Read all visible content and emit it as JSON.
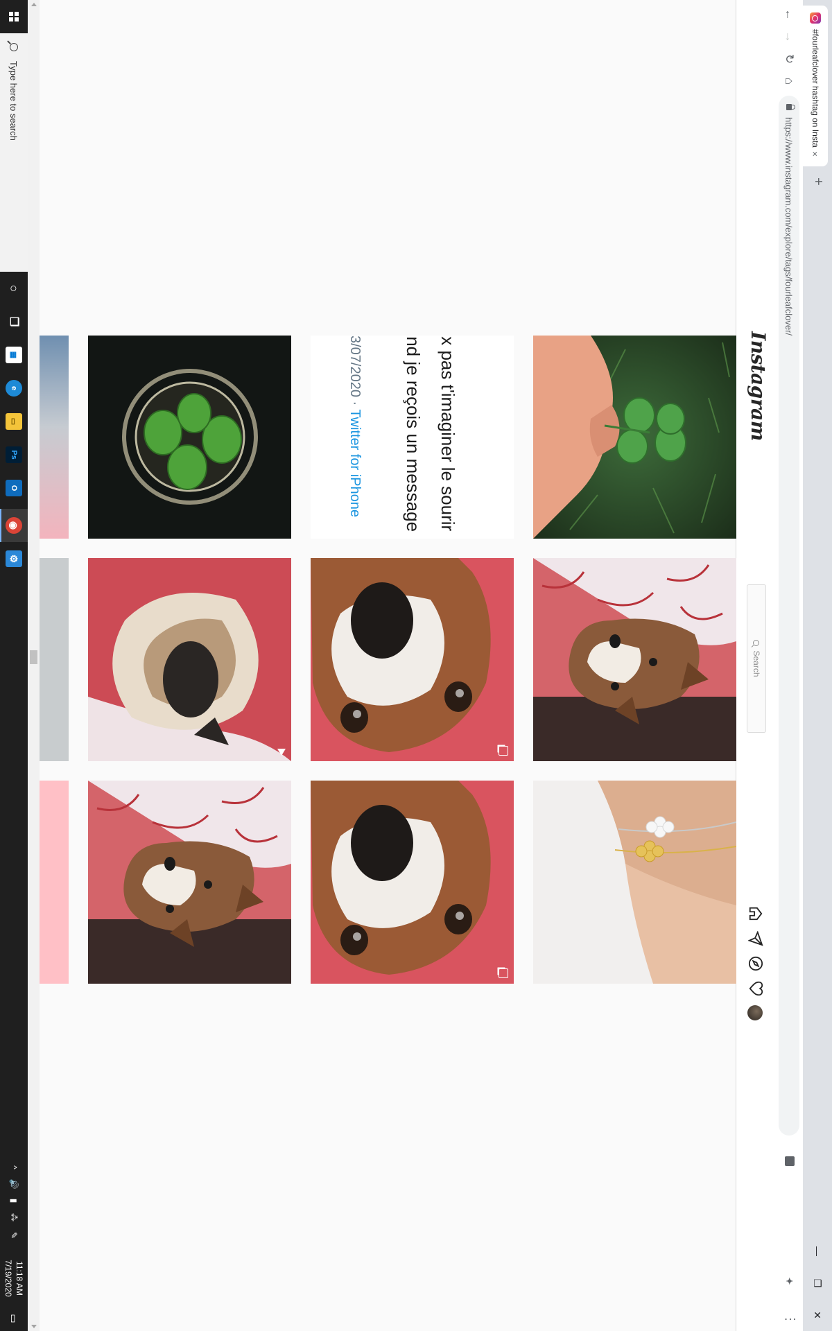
{
  "browser": {
    "tab_title": "#fourleafclover hashtag on Insta",
    "tab_close": "×",
    "new_tab": "+",
    "url": "https://www.instagram.com/explore/tags/fourleafclover/",
    "window_controls": [
      "—",
      "❐",
      "✕"
    ],
    "nav": {
      "back": "←",
      "forward": "→",
      "reload": "↻",
      "home": "⌂"
    },
    "extensions": [
      {
        "icon": "z-extension-icon",
        "color": "#8a6d5a",
        "glyph": "Z"
      },
      {
        "icon": "puzzle-extension-icon",
        "color": "#5f6368",
        "glyph": "✦"
      },
      {
        "icon": "image-extension-icon",
        "color": "#3b5b3b",
        "glyph": "▣"
      },
      {
        "icon": "b-extension-icon",
        "color": "#2b7de9",
        "glyph": "B"
      },
      {
        "icon": "circle-extension-icon",
        "color": "#9aa0a6",
        "glyph": "●"
      },
      {
        "icon": "x-extension-icon",
        "color": "#f97316",
        "glyph": "✕"
      },
      {
        "icon": "g-extension-icon",
        "color": "#8e8e8e",
        "glyph": "G"
      }
    ],
    "menu": "⋮",
    "split_icon": "▥"
  },
  "instagram": {
    "logo": "Instagram",
    "search_placeholder": "Search",
    "nav_icons": [
      "home-icon",
      "direct-icon",
      "explore-icon",
      "activity-icon",
      "avatar"
    ]
  },
  "posts": [
    {
      "name": "post-clover-fingers",
      "row": 0,
      "col": 0,
      "badge": ""
    },
    {
      "name": "post-corgi-blanket",
      "row": 0,
      "col": 1,
      "badge": ""
    },
    {
      "name": "post-clover-bracelet",
      "row": 0,
      "col": 2,
      "badge": ""
    },
    {
      "name": "post-tweet",
      "row": 1,
      "col": 0,
      "badge": ""
    },
    {
      "name": "post-corgi-closeup",
      "row": 1,
      "col": 1,
      "badge": "multi"
    },
    {
      "name": "post-corgi-closeup-2",
      "row": 1,
      "col": 2,
      "badge": "multi"
    },
    {
      "name": "post-clover-glass",
      "row": 2,
      "col": 0,
      "badge": ""
    },
    {
      "name": "post-corgi-back",
      "row": 2,
      "col": 1,
      "badge": "video"
    },
    {
      "name": "post-corgi-blanket-2",
      "row": 2,
      "col": 2,
      "badge": ""
    }
  ],
  "tweet": {
    "line1": "ıx pas t'imaginer le sourir",
    "line2": "ınd je reçois un message",
    "date": "3/07/2020 · ",
    "source": "Twitter for iPhone"
  },
  "taskbar": {
    "search_text": "Type here to search",
    "time": "11:18 AM",
    "date": "7/19/2020",
    "apps": [
      {
        "name": "cortana-icon",
        "color": "transparent",
        "glyph": "○"
      },
      {
        "name": "task-view-icon",
        "color": "transparent",
        "glyph": "❐"
      },
      {
        "name": "store-icon",
        "color": "#ffffff",
        "glyph": "▦"
      },
      {
        "name": "edge-icon",
        "color": "#1e8ad6",
        "glyph": "e"
      },
      {
        "name": "file-explorer-icon",
        "color": "#f4c43a",
        "glyph": "▭"
      },
      {
        "name": "photoshop-icon",
        "color": "#001e36",
        "glyph": "Ps"
      },
      {
        "name": "outlook-icon",
        "color": "#0f6cbd",
        "glyph": "O"
      },
      {
        "name": "chrome-icon",
        "color": "#db4437",
        "glyph": "◉"
      },
      {
        "name": "settings-app-icon",
        "color": "#2b88d8",
        "glyph": "⚙"
      }
    ],
    "tray": [
      "^",
      "🔊",
      "▮",
      "⁂",
      "✎"
    ],
    "notifications": "▭"
  }
}
